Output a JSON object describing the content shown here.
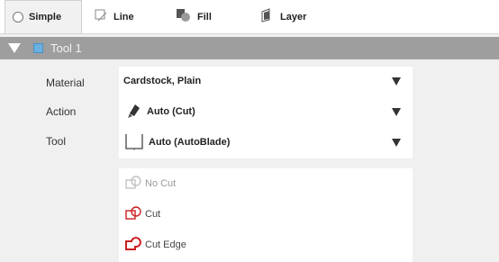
{
  "tabs": {
    "simple": "Simple",
    "line": "Line",
    "fill": "Fill",
    "layer": "Layer"
  },
  "tool": {
    "title": "Tool 1"
  },
  "properties": {
    "material_label": "Material",
    "material_value": "Cardstock, Plain",
    "action_label": "Action",
    "action_value": "Auto (Cut)",
    "tool_label": "Tool",
    "tool_value": "Auto (AutoBlade)"
  },
  "cut_options": [
    {
      "label": "No Cut",
      "color": "#aaaaaa"
    },
    {
      "label": "Cut",
      "color": "#cc1f1f"
    },
    {
      "label": "Cut Edge",
      "color": "#cc1f1f"
    }
  ],
  "colors": {
    "header": "#9e9e9e",
    "cut_red": "#cc1f1f"
  }
}
